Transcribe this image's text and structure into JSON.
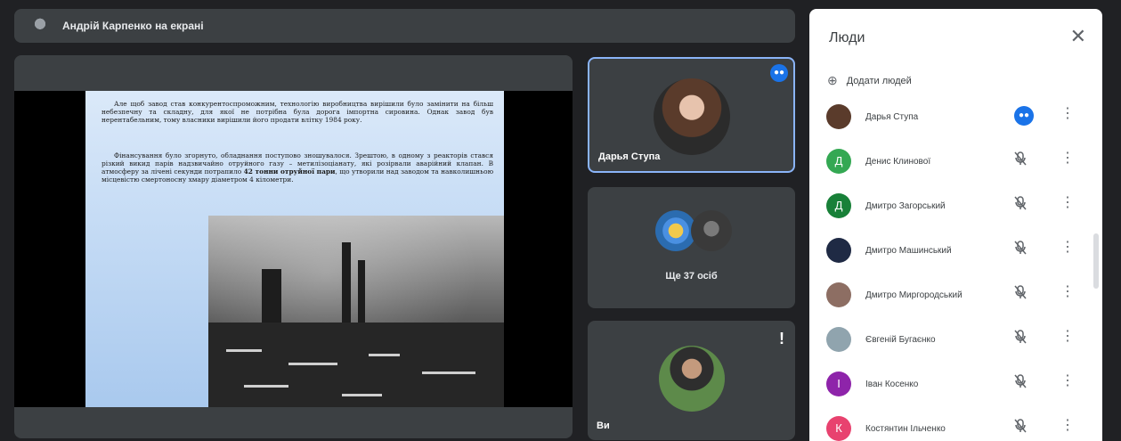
{
  "topbar": {
    "presenting": "Андрій Карпенко на екрані"
  },
  "slide": {
    "paragraph1": "Але щоб завод став конкурентоспроможним, технологію виробництва вирішили було замінити на більш небезпечну та складну, для якої не потрібна була дорога імпортна сировина. Однак завод був нерентабельним, тому власники вирішили його продати влітку 1984 року.",
    "paragraph2_a": "Фінансування було згорнуто, обладнання поступово зношувалося. Зрештою, в одному з реакторів стався різкий викид парів надзвичайно отруйного газу – метилізоціанату, які розірвали аварійний клапан. В атмосферу за лічені секунди потрапило ",
    "paragraph2_bold": "42 тонни отруйної пари",
    "paragraph2_b": ", що утворили над заводом та навколишньою місцевістю смертоносну хмару діаметром 4 кілометри."
  },
  "tiles": {
    "speaker_name": "Дарья Ступа",
    "more_label": "Ще 37 осіб",
    "self_name": "Ви",
    "speaking_icon": "audio-wave-icon",
    "alert_icon": "exclamation-icon"
  },
  "people_panel": {
    "title": "Люди",
    "close_icon": "close-icon",
    "add_people_label": "Додати людей",
    "participants": [
      {
        "name": "Дарья Ступа",
        "initial": "",
        "color": "#5a3b2b",
        "mic": "speaking"
      },
      {
        "name": "Денис Клинової",
        "initial": "Д",
        "color": "#34a853",
        "mic": "muted"
      },
      {
        "name": "Дмитро Загорський",
        "initial": "Д",
        "color": "#188038",
        "mic": "muted"
      },
      {
        "name": "Дмитро Машинський",
        "initial": "",
        "color": "#1f2a44",
        "mic": "muted"
      },
      {
        "name": "Дмитро Миргородський",
        "initial": "",
        "color": "#8d6e63",
        "mic": "muted"
      },
      {
        "name": "Євгеній Бугаєнко",
        "initial": "",
        "color": "#90a4ae",
        "mic": "muted"
      },
      {
        "name": "Іван Косенко",
        "initial": "І",
        "color": "#8e24aa",
        "mic": "muted"
      },
      {
        "name": "Костянтин Ільченко",
        "initial": "К",
        "color": "#e8426f",
        "mic": "muted"
      }
    ]
  },
  "colors": {
    "accent": "#1a73e8",
    "highlight_border": "#8ab4f8",
    "background": "#202124",
    "tile": "#3c4043"
  }
}
